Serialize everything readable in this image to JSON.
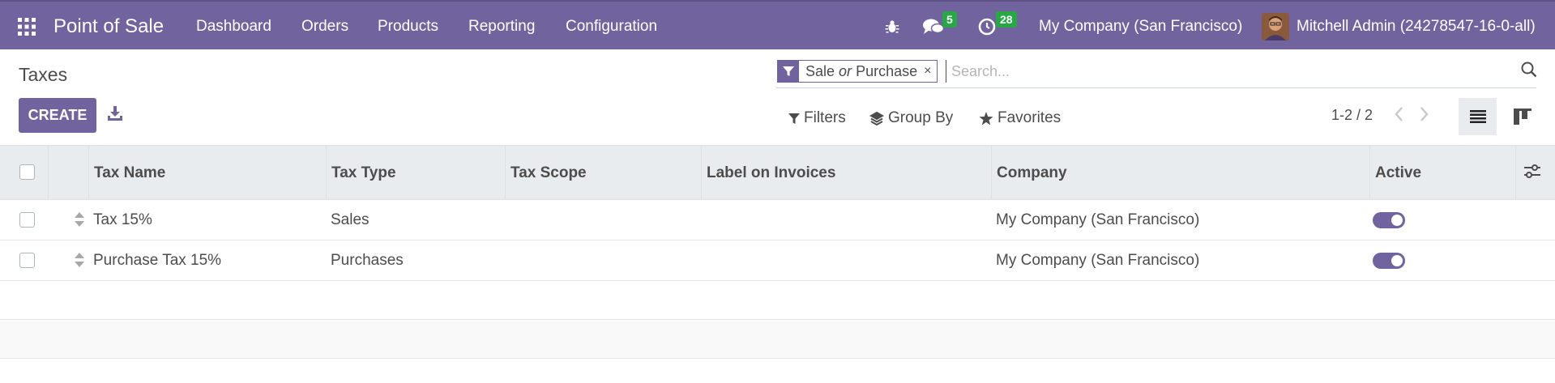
{
  "topbar": {
    "app_title": "Point of Sale",
    "nav": [
      "Dashboard",
      "Orders",
      "Products",
      "Reporting",
      "Configuration"
    ],
    "messages_count": "5",
    "activities_count": "28",
    "company": "My Company (San Francisco)",
    "user": "Mitchell Admin (24278547-16-0-all)"
  },
  "page": {
    "title": "Taxes",
    "create_label": "CREATE"
  },
  "search": {
    "facet_part1": "Sale",
    "facet_or": "or",
    "facet_part2": "Purchase",
    "facet_remove": "×",
    "placeholder": "Search..."
  },
  "controls": {
    "filters": "Filters",
    "group_by": "Group By",
    "favorites": "Favorites",
    "pager": "1-2 / 2"
  },
  "table": {
    "columns": [
      "Tax Name",
      "Tax Type",
      "Tax Scope",
      "Label on Invoices",
      "Company",
      "Active"
    ],
    "rows": [
      {
        "name": "Tax 15%",
        "type": "Sales",
        "scope": "",
        "label": "",
        "company": "My Company (San Francisco)",
        "active": true
      },
      {
        "name": "Purchase Tax 15%",
        "type": "Purchases",
        "scope": "",
        "label": "",
        "company": "My Company (San Francisco)",
        "active": true
      }
    ]
  },
  "colors": {
    "brand": "#71639e",
    "badge": "#28a745",
    "header_bg": "#e9ecef"
  },
  "icons": [
    "apps-grid-icon",
    "bug-icon",
    "chat-icon",
    "clock-icon",
    "avatar",
    "download-icon",
    "filter-icon",
    "search-icon",
    "layers-icon",
    "star-icon",
    "chevron-left-icon",
    "chevron-right-icon",
    "list-view-icon",
    "kanban-view-icon",
    "column-settings-icon",
    "drag-handle-icon"
  ]
}
